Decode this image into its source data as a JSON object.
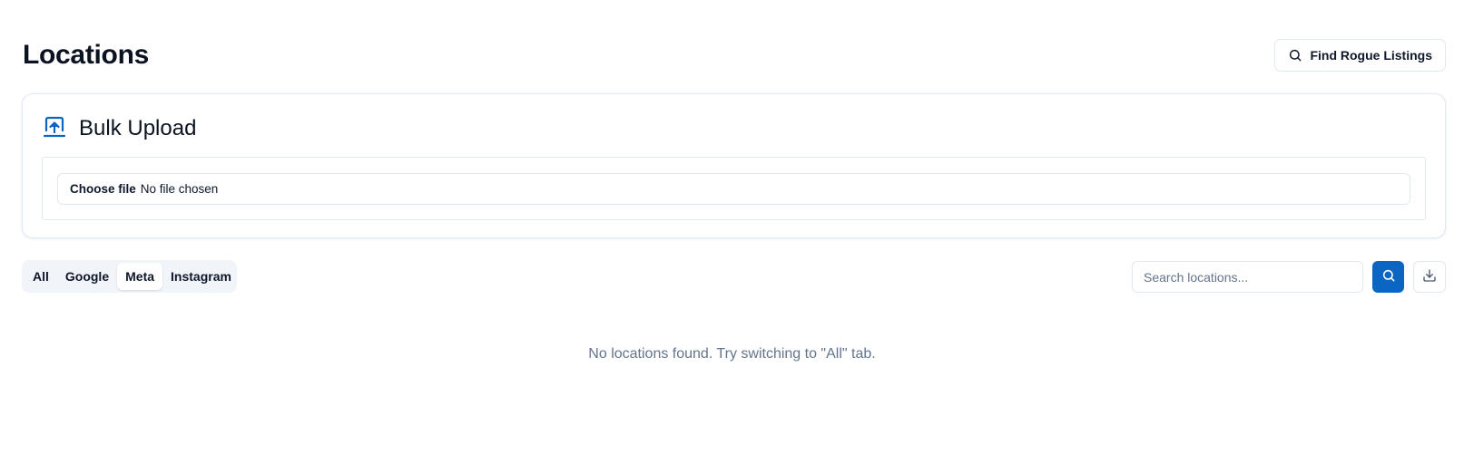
{
  "header": {
    "title": "Locations",
    "rogue_button_label": "Find Rogue Listings",
    "rogue_button_icon": "search-icon"
  },
  "bulk_upload": {
    "icon": "upload-icon",
    "title": "Bulk Upload",
    "file_button_label": "Choose file",
    "file_status": "No file chosen"
  },
  "tabs": [
    {
      "label": "All",
      "active": false
    },
    {
      "label": "Google",
      "active": false
    },
    {
      "label": "Meta",
      "active": true
    },
    {
      "label": "Instagram",
      "active": false
    }
  ],
  "search": {
    "placeholder": "Search locations...",
    "value": "",
    "button_icon": "search-icon"
  },
  "download_icon": "download-icon",
  "empty_message": "No locations found. Try switching to \"All\" tab.",
  "colors": {
    "accent": "#0a66c2",
    "border": "#e2e8f0",
    "muted_text": "#64748b",
    "tab_bg": "#f1f5f9"
  }
}
